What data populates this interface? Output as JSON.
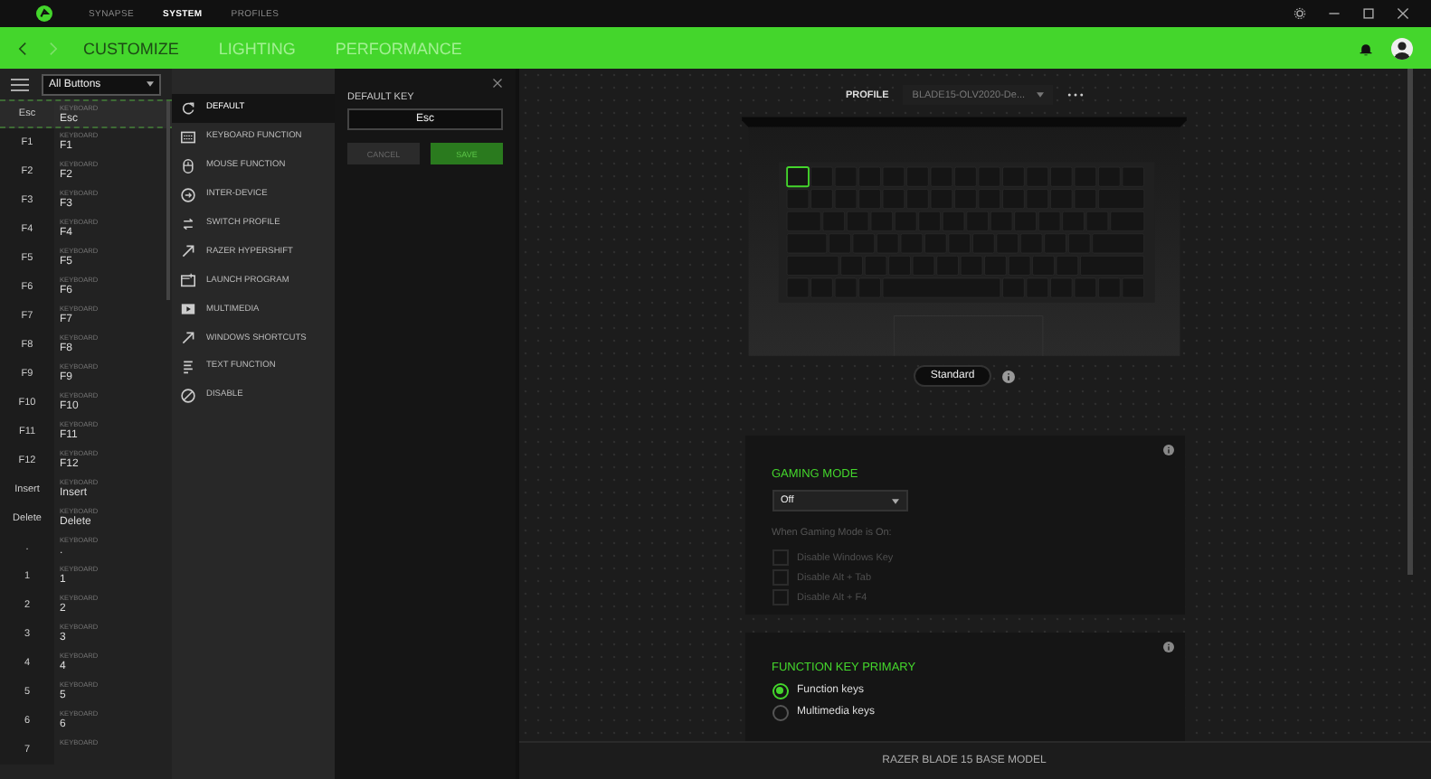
{
  "top_tabs": [
    {
      "label": "SYNAPSE",
      "selected": false
    },
    {
      "label": "SYSTEM",
      "selected": true
    },
    {
      "label": "PROFILES",
      "selected": false
    }
  ],
  "sub_tabs": [
    {
      "label": "CUSTOMIZE",
      "selected": true
    },
    {
      "label": "LIGHTING",
      "selected": false
    },
    {
      "label": "PERFORMANCE",
      "selected": false
    }
  ],
  "key_list": {
    "filter": "All Buttons",
    "rows": [
      {
        "key": "Esc",
        "category": "KEYBOARD",
        "value": "Esc",
        "selected": true
      },
      {
        "key": "F1",
        "category": "KEYBOARD",
        "value": "F1",
        "selected": false
      },
      {
        "key": "F2",
        "category": "KEYBOARD",
        "value": "F2",
        "selected": false
      },
      {
        "key": "F3",
        "category": "KEYBOARD",
        "value": "F3",
        "selected": false
      },
      {
        "key": "F4",
        "category": "KEYBOARD",
        "value": "F4",
        "selected": false
      },
      {
        "key": "F5",
        "category": "KEYBOARD",
        "value": "F5",
        "selected": false
      },
      {
        "key": "F6",
        "category": "KEYBOARD",
        "value": "F6",
        "selected": false
      },
      {
        "key": "F7",
        "category": "KEYBOARD",
        "value": "F7",
        "selected": false
      },
      {
        "key": "F8",
        "category": "KEYBOARD",
        "value": "F8",
        "selected": false
      },
      {
        "key": "F9",
        "category": "KEYBOARD",
        "value": "F9",
        "selected": false
      },
      {
        "key": "F10",
        "category": "KEYBOARD",
        "value": "F10",
        "selected": false
      },
      {
        "key": "F11",
        "category": "KEYBOARD",
        "value": "F11",
        "selected": false
      },
      {
        "key": "F12",
        "category": "KEYBOARD",
        "value": "F12",
        "selected": false
      },
      {
        "key": "Insert",
        "category": "KEYBOARD",
        "value": "Insert",
        "selected": false
      },
      {
        "key": "Delete",
        "category": "KEYBOARD",
        "value": "Delete",
        "selected": false
      },
      {
        "key": ".",
        "category": "KEYBOARD",
        "value": ".",
        "selected": false
      },
      {
        "key": "1",
        "category": "KEYBOARD",
        "value": "1",
        "selected": false
      },
      {
        "key": "2",
        "category": "KEYBOARD",
        "value": "2",
        "selected": false
      },
      {
        "key": "3",
        "category": "KEYBOARD",
        "value": "3",
        "selected": false
      },
      {
        "key": "4",
        "category": "KEYBOARD",
        "value": "4",
        "selected": false
      },
      {
        "key": "5",
        "category": "KEYBOARD",
        "value": "5",
        "selected": false
      },
      {
        "key": "6",
        "category": "KEYBOARD",
        "value": "6",
        "selected": false
      },
      {
        "key": "7",
        "category": "KEYBOARD",
        "selected": false
      }
    ]
  },
  "functions": [
    {
      "label": "DEFAULT",
      "selected": true
    },
    {
      "label": "KEYBOARD FUNCTION",
      "selected": false
    },
    {
      "label": "MOUSE FUNCTION",
      "selected": false
    },
    {
      "label": "INTER-DEVICE",
      "selected": false
    },
    {
      "label": "SWITCH PROFILE",
      "selected": false
    },
    {
      "label": "RAZER HYPERSHIFT",
      "selected": false
    },
    {
      "label": "LAUNCH PROGRAM",
      "selected": false
    },
    {
      "label": "MULTIMEDIA",
      "selected": false
    },
    {
      "label": "WINDOWS SHORTCUTS",
      "selected": false
    },
    {
      "label": "TEXT FUNCTION",
      "selected": false
    },
    {
      "label": "DISABLE",
      "selected": false
    }
  ],
  "assign_panel": {
    "title": "DEFAULT KEY",
    "value": "Esc",
    "buttons": [
      {
        "label": "CANCEL",
        "kind": "secondary"
      },
      {
        "label": "SAVE",
        "kind": "primary"
      }
    ]
  },
  "profile": {
    "label": "PROFILE",
    "value": "BLADE15-OLV2020-De..."
  },
  "layout_toggle": {
    "label": "Standard"
  },
  "gaming_mode": {
    "title": "GAMING MODE",
    "mode": "Off",
    "note": "When Gaming Mode is On:",
    "options": [
      {
        "label": "Disable Windows Key",
        "checked": false,
        "disabled": true
      },
      {
        "label": "Disable Alt + Tab",
        "checked": false,
        "disabled": true
      },
      {
        "label": "Disable Alt + F4",
        "checked": false,
        "disabled": true
      }
    ]
  },
  "function_key_primary": {
    "title": "FUNCTION KEY PRIMARY",
    "options": [
      {
        "label": "Function keys",
        "selected": true
      },
      {
        "label": "Multimedia keys",
        "selected": false
      }
    ]
  },
  "status_bar": "RAZER BLADE 15 BASE MODEL"
}
